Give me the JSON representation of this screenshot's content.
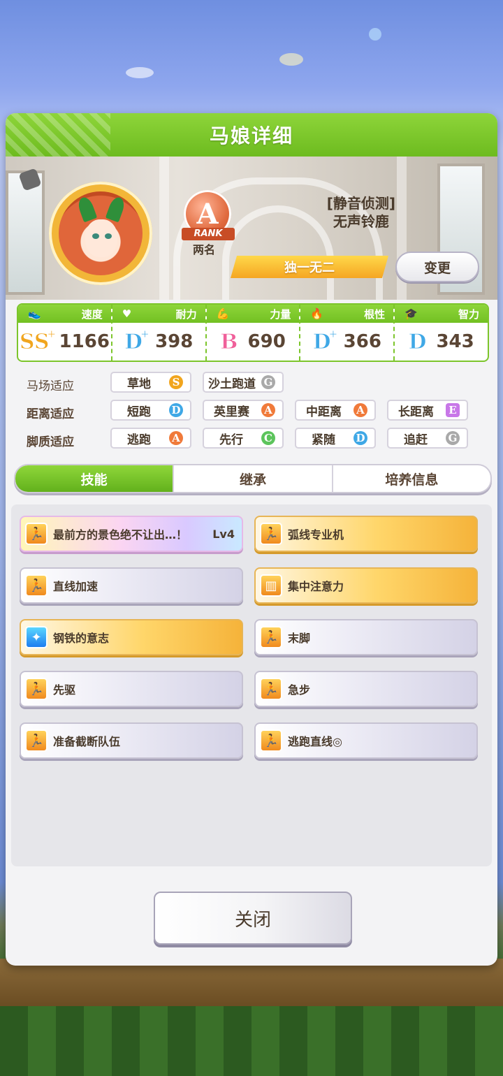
{
  "header": {
    "title": "马娘详细"
  },
  "profile": {
    "rank_letter": "A",
    "rank_label": "RANK",
    "rank_place": "两名",
    "title_line1": "[静音侦测]",
    "title_line2": "无声铃鹿",
    "unique_label": "独一无二",
    "change_button": "变更"
  },
  "stats": [
    {
      "label": "速度",
      "icon": "shoe-icon",
      "grade": "SS",
      "plus": "+",
      "value": "1166",
      "color": "#f1a51d"
    },
    {
      "label": "耐力",
      "icon": "heart-icon",
      "grade": "D",
      "plus": "+",
      "value": "398",
      "color": "#3fa8e6"
    },
    {
      "label": "力量",
      "icon": "muscle-icon",
      "grade": "B",
      "plus": "",
      "value": "690",
      "color": "#f0609a"
    },
    {
      "label": "根性",
      "icon": "fire-icon",
      "grade": "D",
      "plus": "+",
      "value": "366",
      "color": "#3fa8e6"
    },
    {
      "label": "智力",
      "icon": "graduation-cap-icon",
      "grade": "D",
      "plus": "",
      "value": "343",
      "color": "#3fa8e6"
    }
  ],
  "aptitude": {
    "track": {
      "label": "马场适应",
      "items": [
        {
          "name": "草地",
          "grade": "S",
          "color": "#f1a51d"
        },
        {
          "name": "沙土跑道",
          "grade": "G",
          "color": "#a9a9a9"
        }
      ]
    },
    "distance": {
      "label": "距离适应",
      "items": [
        {
          "name": "短跑",
          "grade": "D",
          "color": "#3fa8e6"
        },
        {
          "name": "英里赛",
          "grade": "A",
          "color": "#f07a3a"
        },
        {
          "name": "中距离",
          "grade": "A",
          "color": "#f07a3a"
        },
        {
          "name": "长距离",
          "grade": "E",
          "color": "#c877e8"
        }
      ]
    },
    "style": {
      "label": "脚质适应",
      "items": [
        {
          "name": "逃跑",
          "grade": "A",
          "color": "#f07a3a"
        },
        {
          "name": "先行",
          "grade": "C",
          "color": "#5cc45c"
        },
        {
          "name": "紧随",
          "grade": "D",
          "color": "#3fa8e6"
        },
        {
          "name": "追赶",
          "grade": "G",
          "color": "#a9a9a9"
        }
      ]
    }
  },
  "tabs": [
    "技能",
    "继承",
    "培养信息"
  ],
  "skills": [
    {
      "name": "最前方的景色绝不让出…！",
      "lv": "Lv4",
      "style": "rainbow",
      "icon": "runner-icon"
    },
    {
      "name": "弧线专业机",
      "lv": "",
      "style": "gold",
      "icon": "runner-icon"
    },
    {
      "name": "直线加速",
      "lv": "",
      "style": "white",
      "icon": "runner-icon"
    },
    {
      "name": "集中注意力",
      "lv": "",
      "style": "gold",
      "icon": "gate-icon"
    },
    {
      "name": "钢铁的意志",
      "lv": "",
      "style": "gold",
      "icon": "sparkle-icon"
    },
    {
      "name": "末脚",
      "lv": "",
      "style": "white",
      "icon": "runner-icon"
    },
    {
      "name": "先驱",
      "lv": "",
      "style": "white",
      "icon": "runner-icon"
    },
    {
      "name": "急步",
      "lv": "",
      "style": "white",
      "icon": "runner-icon"
    },
    {
      "name": "准备截断队伍",
      "lv": "",
      "style": "white",
      "icon": "runner-icon"
    },
    {
      "name": "逃跑直线◎",
      "lv": "",
      "style": "white",
      "icon": "runner-icon"
    }
  ],
  "close_button": "关闭"
}
